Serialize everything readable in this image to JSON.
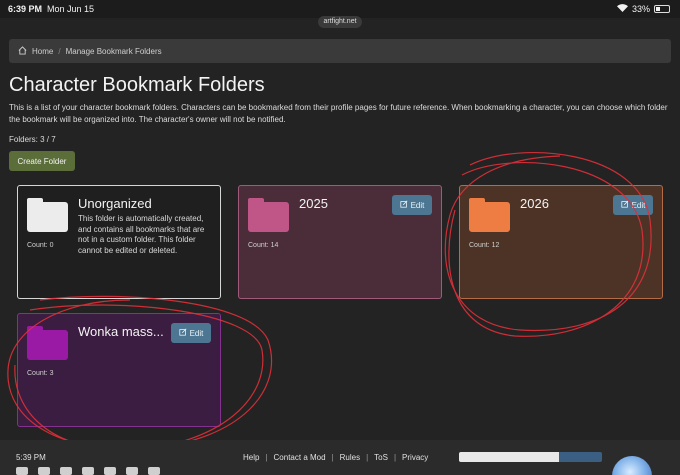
{
  "status_bar": {
    "time": "6:39 PM",
    "date": "Mon Jun 15",
    "battery": "33%",
    "battery_level": 0.33,
    "url": "artfight.net"
  },
  "breadcrumb": {
    "home": "Home",
    "current": "Manage Bookmark Folders"
  },
  "page": {
    "title": "Character Bookmark Folders",
    "description": "This is a list of your character bookmark folders. Characters can be bookmarked from their profile pages for future reference. When bookmarking a character, you can choose which folder the bookmark will be organized into. The character's owner will not be notified.",
    "folders_count": "Folders: 3 / 7",
    "create_label": "Create Folder"
  },
  "cards": {
    "unorganized": {
      "title": "Unorganized",
      "count": "Count: 0",
      "description": "This folder is automatically created, and contains all bookmarks that are not in a custom folder. This folder cannot be edited or deleted.",
      "color": "#ececec"
    },
    "c2025": {
      "title": "2025",
      "count": "Count: 14",
      "edit": "Edit",
      "color": "#c05688"
    },
    "c2026": {
      "title": "2026",
      "count": "Count: 12",
      "edit": "Edit",
      "color": "#ee7d43"
    },
    "wonka": {
      "title": "Wonka mass...",
      "count": "Count: 3",
      "edit": "Edit",
      "color": "#9b1aa5"
    }
  },
  "footer": {
    "time": "5:39 PM",
    "links": [
      "Help",
      "Contact a Mod",
      "Rules",
      "ToS",
      "Privacy"
    ],
    "progress_fraction": 0.7
  }
}
